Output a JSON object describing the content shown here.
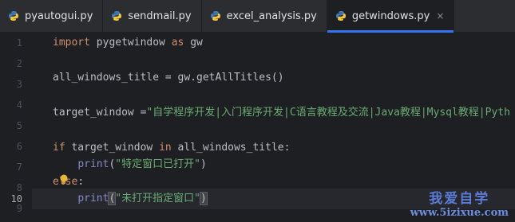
{
  "tabs": [
    {
      "label": "pyautogui.py",
      "active": false
    },
    {
      "label": "sendmail.py",
      "active": false
    },
    {
      "label": "excel_analysis.py",
      "active": false
    },
    {
      "label": "getwindows.py",
      "active": true
    }
  ],
  "tab_close_glyph": "×",
  "line_numbers": [
    "1",
    "2",
    "3",
    "4",
    "5",
    "6",
    "7",
    "8",
    "9",
    "10"
  ],
  "current_line": "10",
  "code": {
    "l1": {
      "kw_import": "import",
      "mod": " pygetwindow ",
      "kw_as": "as",
      "alias": " gw"
    },
    "l3": {
      "text": "all_windows_title = gw.getAllTitles()"
    },
    "l5": {
      "lhs": "target_window =",
      "str": "\"自学程序开发|入门程序开发|C语言教程及交流|Java教程|Mysql教程|Pyth"
    },
    "l7": {
      "kw_if": "if",
      "mid": " target_window ",
      "kw_in": "in",
      "rest": " all_windows_title:"
    },
    "l8": {
      "indent": "    ",
      "fn": "print",
      "open": "(",
      "str": "\"特定窗口已打开\"",
      "close": ")"
    },
    "l9": {
      "kw_else": "else",
      "colon": ":"
    },
    "l10": {
      "indent": "    ",
      "fn": "print",
      "open": "(",
      "str": "\"未打开指定窗口\"",
      "close": ")"
    }
  },
  "watermark": {
    "title": "我爱自学",
    "url": "www.5izixue.com"
  },
  "colors": {
    "editor_bg": "#1e1f22",
    "tab_active_underline": "#3574f0",
    "keyword": "#cf8e6d",
    "string": "#6aab73",
    "builtin": "#8888c6"
  },
  "icons": {
    "tab_icon": "python-icon",
    "hint": "lightbulb-icon"
  }
}
